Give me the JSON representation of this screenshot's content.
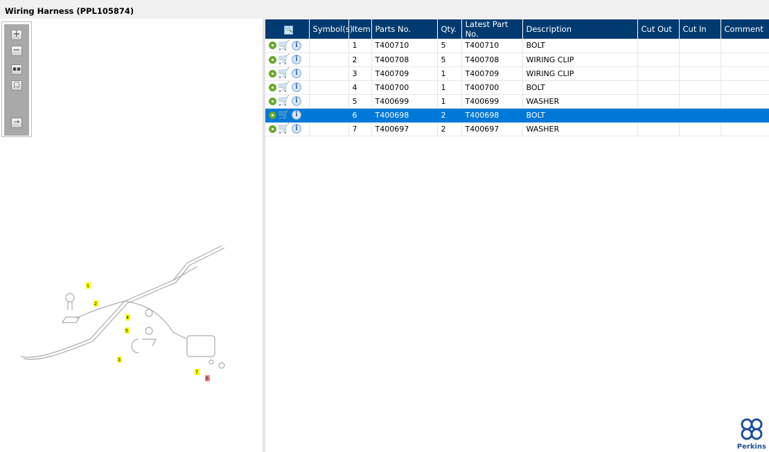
{
  "title": "Wiring Harness (PPL105874)",
  "toolbar": {
    "icons": [
      "zoom-in-icon",
      "zoom-out-icon",
      "fit-icon",
      "actual-size-icon",
      "expand-panel-icon"
    ]
  },
  "table": {
    "headers": [
      "",
      "Symbol(s)",
      "Item",
      "Parts No.",
      "Qty.",
      "Latest Part No.",
      "Description",
      "Cut Out",
      "Cut In",
      "Comment"
    ],
    "rows": [
      {
        "symbols": "",
        "item": "1",
        "part": "T400710",
        "qty": "5",
        "latest": "T400710",
        "desc": "BOLT",
        "cut_out": "",
        "cut_in": "",
        "comment": ""
      },
      {
        "symbols": "",
        "item": "2",
        "part": "T400708",
        "qty": "5",
        "latest": "T400708",
        "desc": "WIRING CLIP",
        "cut_out": "",
        "cut_in": "",
        "comment": ""
      },
      {
        "symbols": "",
        "item": "3",
        "part": "T400709",
        "qty": "1",
        "latest": "T400709",
        "desc": "WIRING CLIP",
        "cut_out": "",
        "cut_in": "",
        "comment": ""
      },
      {
        "symbols": "",
        "item": "4",
        "part": "T400700",
        "qty": "1",
        "latest": "T400700",
        "desc": "BOLT",
        "cut_out": "",
        "cut_in": "",
        "comment": ""
      },
      {
        "symbols": "",
        "item": "5",
        "part": "T400699",
        "qty": "1",
        "latest": "T400699",
        "desc": "WASHER",
        "cut_out": "",
        "cut_in": "",
        "comment": ""
      },
      {
        "symbols": "",
        "item": "6",
        "part": "T400698",
        "qty": "2",
        "latest": "T400698",
        "desc": "BOLT",
        "cut_out": "",
        "cut_in": "",
        "comment": ""
      },
      {
        "symbols": "",
        "item": "7",
        "part": "T400697",
        "qty": "2",
        "latest": "T400697",
        "desc": "WASHER",
        "cut_out": "",
        "cut_in": "",
        "comment": ""
      }
    ],
    "selected_item": "6"
  },
  "diagram": {
    "callouts": [
      "1",
      "2",
      "3",
      "4",
      "5",
      "6",
      "7"
    ],
    "highlight": "6"
  },
  "logo": {
    "text": "Perkins"
  }
}
